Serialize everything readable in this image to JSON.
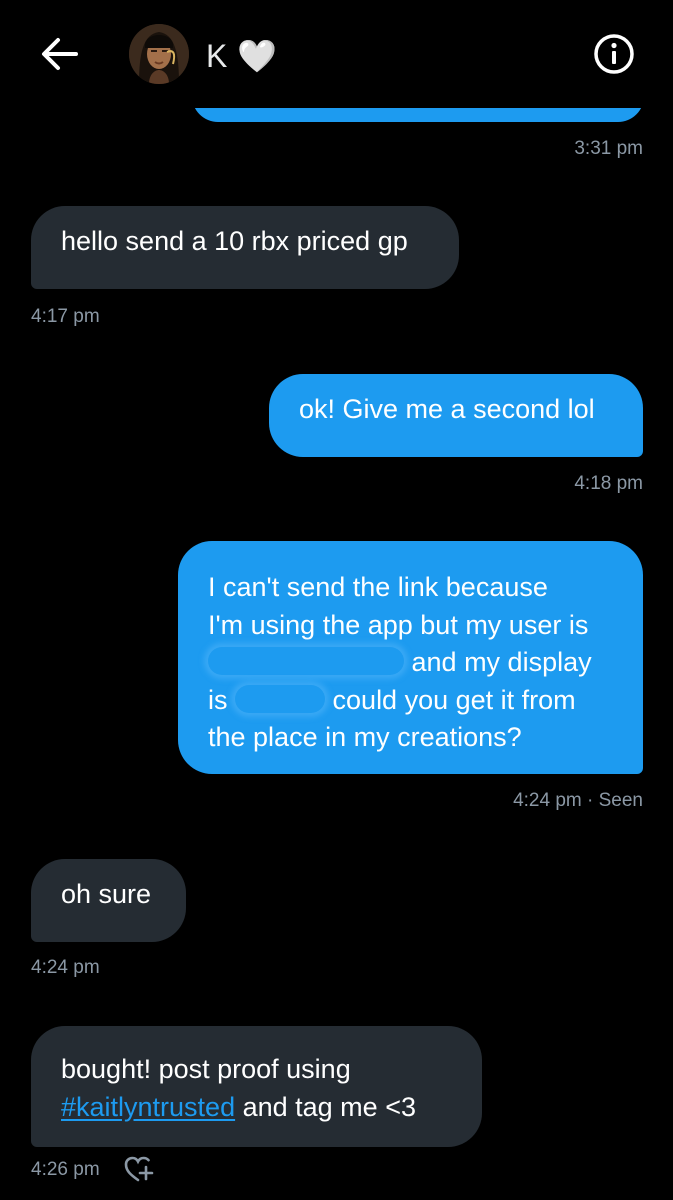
{
  "header": {
    "contact_name": "K 🤍",
    "back_icon": "arrow-left-icon",
    "info_icon": "info-circle-icon"
  },
  "messages": [
    {
      "direction": "outgoing",
      "text": "",
      "time": "3:31 pm"
    },
    {
      "direction": "incoming",
      "text": "hello send a 10 rbx priced gp",
      "time": "4:17 pm"
    },
    {
      "direction": "outgoing",
      "text": "ok! Give me a second lol",
      "time": "4:18 pm"
    },
    {
      "direction": "outgoing",
      "lines": [
        "I can't send the link because",
        "I'm using the app but my user is",
        "and my display",
        "is",
        "could you get it from",
        "the place in my creations?"
      ],
      "time": "4:24 pm · Seen"
    },
    {
      "direction": "incoming",
      "text": "oh sure",
      "time": "4:24 pm"
    },
    {
      "direction": "incoming",
      "line1": "bought! post proof using",
      "hashtag": "#kaitlyntrusted",
      "line2_rest": " and tag me <3",
      "time": "4:26 pm",
      "reaction_icon": "add-reaction-heart-icon"
    }
  ],
  "colors": {
    "background": "#000000",
    "outgoing_bubble": "#1d9bf0",
    "incoming_bubble": "#252c33",
    "timestamp": "#8b98a5",
    "hashtag": "#1d9bf0"
  }
}
